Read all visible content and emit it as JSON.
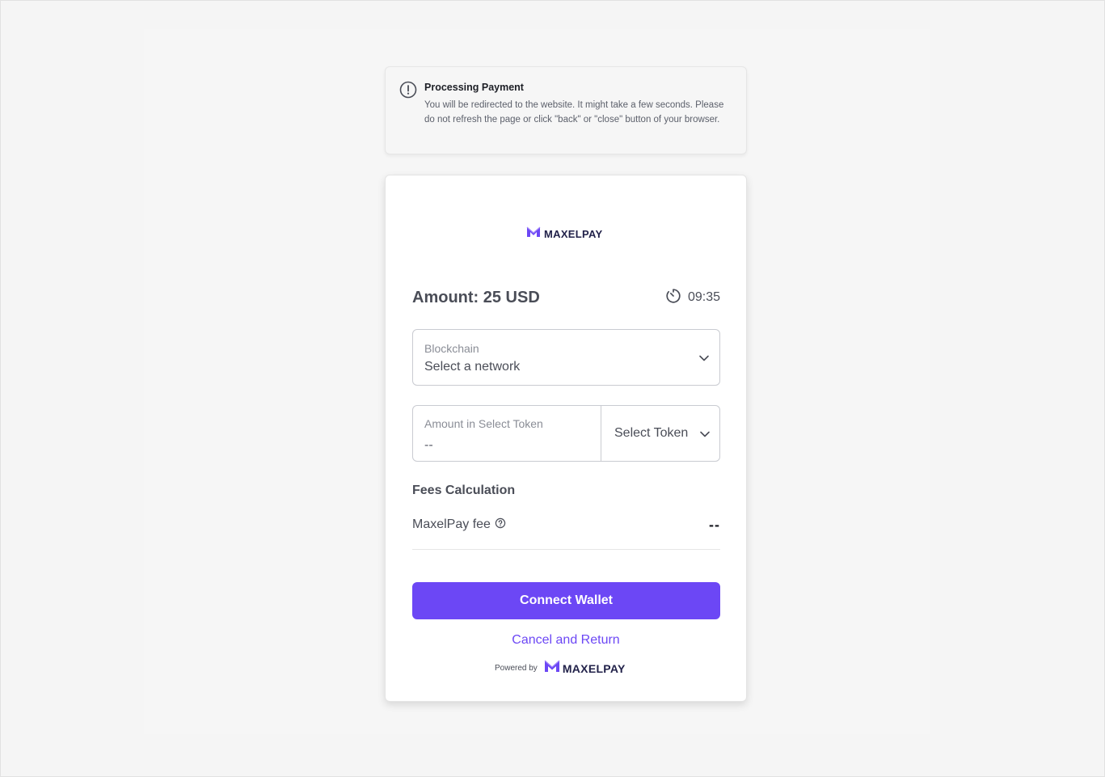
{
  "notice": {
    "title": "Processing Payment",
    "message": "You will be redirected to the website. It might take a few seconds. Please do not refresh the page or click \"back\" or \"close\" button of your browser.",
    "icon": "exclamation-circle-icon"
  },
  "brand": {
    "name": "MAXELPAY",
    "accent_color": "#6c47f5",
    "text_color": "#22224a"
  },
  "payment": {
    "amount_label": "Amount: 25 USD",
    "timer": "09:35"
  },
  "blockchain": {
    "label": "Blockchain",
    "value": "Select a network"
  },
  "token": {
    "amount_label": "Amount in Select Token",
    "amount_value": "--",
    "select_label": "Select Token"
  },
  "fees": {
    "title": "Fees Calculation",
    "maxelpay_fee_label": "MaxelPay fee",
    "maxelpay_fee_value": "--"
  },
  "actions": {
    "connect_label": "Connect Wallet",
    "cancel_label": "Cancel and Return"
  },
  "footer": {
    "powered_by": "Powered by"
  }
}
